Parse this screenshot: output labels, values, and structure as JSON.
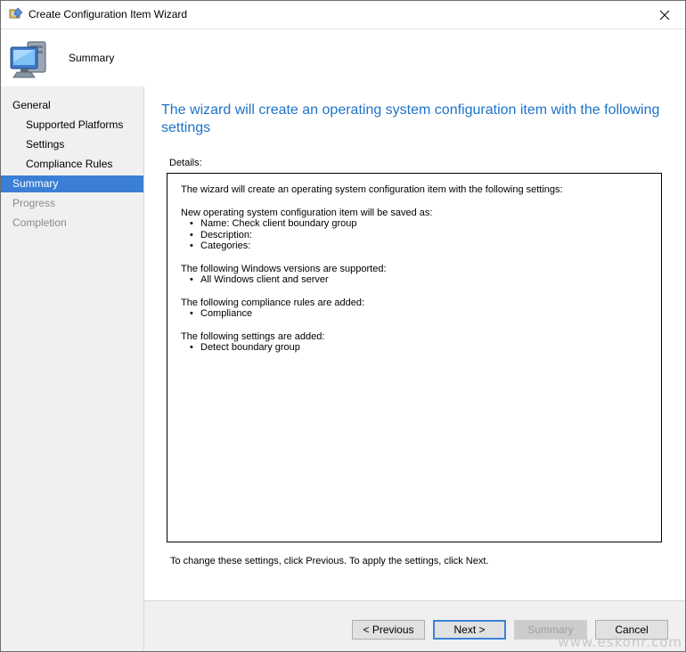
{
  "window": {
    "title": "Create Configuration Item Wizard"
  },
  "header": {
    "title": "Summary"
  },
  "sidebar": {
    "items": [
      {
        "label": "General"
      },
      {
        "label": "Supported Platforms"
      },
      {
        "label": "Settings"
      },
      {
        "label": "Compliance Rules"
      },
      {
        "label": "Summary"
      },
      {
        "label": "Progress"
      },
      {
        "label": "Completion"
      }
    ]
  },
  "main": {
    "heading": "The wizard will create an operating system configuration item with the following settings",
    "details_label": "Details:",
    "details": {
      "intro": "The wizard will create an operating system configuration item with the following settings:",
      "item_header": "New operating system configuration item will be saved as:",
      "item_bullets": [
        "Name: Check client boundary group",
        "Description:",
        "Categories:"
      ],
      "versions_header": "The following Windows versions are supported:",
      "versions_bullets": [
        "All Windows client and server"
      ],
      "rules_header": "The following compliance rules are added:",
      "rules_bullets": [
        "Compliance"
      ],
      "settings_header": "The following settings are added:",
      "settings_bullets": [
        "Detect boundary group"
      ]
    },
    "footnote": "To change these settings, click Previous. To apply the settings, click Next."
  },
  "footer": {
    "previous_label": "< Previous",
    "next_label": "Next >",
    "summary_label": "Summary",
    "cancel_label": "Cancel"
  },
  "watermark": "www.eskonr.com",
  "icons": {
    "app": "wizard-app-icon",
    "header": "computer-icon",
    "close": "close-icon"
  },
  "colors": {
    "accent": "#3a7fd5",
    "heading": "#1e73c9",
    "button_focus": "#3b82d9"
  }
}
